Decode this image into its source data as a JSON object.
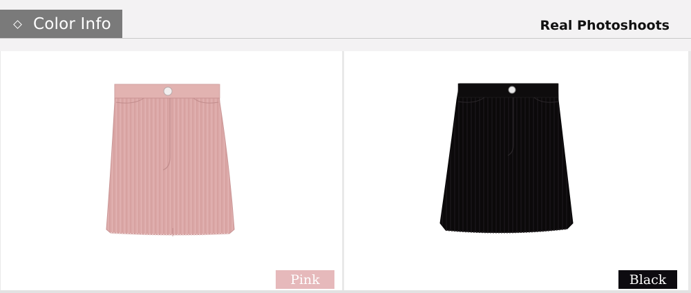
{
  "header": {
    "tab_label": "Color Info",
    "tab_icon": "diamond-icon",
    "subtitle": "Real Photoshoots"
  },
  "colors": [
    {
      "name": "Pink",
      "swatch_color": "#e6b9bb",
      "product_color": "#dba9a7"
    },
    {
      "name": "Black",
      "swatch_color": "#0d0b10",
      "product_color": "#0a0809"
    }
  ]
}
